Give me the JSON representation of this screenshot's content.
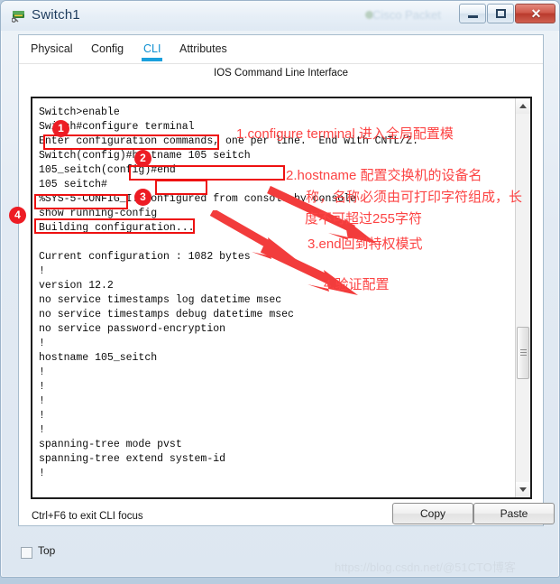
{
  "window": {
    "title": "Switch1",
    "ghost_title": "Cisco Packet",
    "icon": "switch-icon",
    "minimize_label": "–",
    "maximize_label": "□",
    "close_label": "✕"
  },
  "tabs": [
    {
      "label": "Physical",
      "active": false
    },
    {
      "label": "Config",
      "active": false
    },
    {
      "label": "CLI",
      "active": true
    },
    {
      "label": "Attributes",
      "active": false
    }
  ],
  "panel": {
    "title": "IOS Command Line Interface"
  },
  "terminal": {
    "lines": [
      "Switch>enable",
      "Switch#configure terminal",
      "Enter configuration commands, one per line.  End with CNTL/Z.",
      "Switch(config)#hostname 105 seitch",
      "105_seitch(config)#end",
      "105 seitch#",
      "%SYS-5-CONFIG_I: Configured from console by console",
      "show running-config",
      "Building configuration...",
      "",
      "Current configuration : 1082 bytes",
      "!",
      "version 12.2",
      "no service timestamps log datetime msec",
      "no service timestamps debug datetime msec",
      "no service password-encryption",
      "!",
      "hostname 105_seitch",
      "!",
      "!",
      "!",
      "!",
      "!",
      "spanning-tree mode pvst",
      "spanning-tree extend system-id",
      "!"
    ]
  },
  "annotations": {
    "badges": [
      "1",
      "2",
      "3",
      "4"
    ],
    "notes": [
      "1.configure terminal 进入全局配置模",
      "2.hostname 配置交换机的设备名",
      "称，名称必须由可打印字符组成，长",
      "度不可超过255字符",
      "3.end回到特权模式",
      "4.验证配置"
    ],
    "accent_color": "#ed1c24"
  },
  "footer": {
    "hint": "Ctrl+F6 to exit CLI focus",
    "copy_label": "Copy",
    "paste_label": "Paste"
  },
  "bottom": {
    "top_checkbox_label": "Top",
    "watermark": "https://blog.csdn.net/@51CTO博客"
  }
}
